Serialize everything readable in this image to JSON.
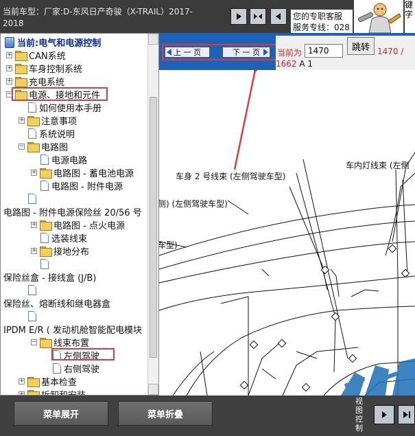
{
  "header": {
    "vehicle_line1": "当前车型：厂家:D-东风日产奇骏（X-TRAIL）2017-",
    "vehicle_line2": "2018",
    "service_line1": "您的专职客服",
    "service_line2": "服务专线：028",
    "edge_text": "键字"
  },
  "tree": {
    "root": "当前:电气和电源控制",
    "items": [
      {
        "label": "CAN系统"
      },
      {
        "label": "车身控制系统"
      },
      {
        "label": "充电系统"
      },
      {
        "label": "电源、接地和元件"
      },
      {
        "label": "如何使用本手册"
      },
      {
        "label": "注意事项"
      },
      {
        "label": "系统说明"
      },
      {
        "label": "电路图"
      },
      {
        "label": "电源电路"
      },
      {
        "label": "电路图 - 蓄电池电源"
      },
      {
        "label": "电路图 - 附件电源"
      },
      {
        "label": "电路图 - 附件电源保险丝 20/56 号"
      },
      {
        "label": "电路图 - 点火电源"
      },
      {
        "label": "选装线束"
      },
      {
        "label": "接地分布"
      },
      {
        "label": "保险丝盒 - 接线盒 (J/B)"
      },
      {
        "label": "保险丝、熔断线和继电器盒"
      },
      {
        "label": "IPDM E/R ( 发动机舱智能配电模块"
      },
      {
        "label": "线束布置"
      },
      {
        "label": "左侧驾驶"
      },
      {
        "label": "右侧驾驶"
      },
      {
        "label": "基本检查"
      },
      {
        "label": "拆卸和安装"
      }
    ]
  },
  "viewer": {
    "prev_label": "上 一 页",
    "next_label": "下 一 页",
    "current_label": "当前为",
    "page_value": "1470",
    "jump_label": "跳转",
    "page_of": "1470 /",
    "page_total": "1662",
    "page_suffix": "A 1"
  },
  "diagram": {
    "label_body_harness": "车身 2 号线束 (左侧驾驶车型)",
    "label_roof_harness": "车内灯线束 (左侧",
    "label_left_drive": "侧) (左侧驾驶车型)",
    "label_model": "车型)"
  },
  "bottom": {
    "expand_label": "菜单展开",
    "collapse_label": "菜单折叠",
    "view_ctrl": "视图控制"
  },
  "colors": {
    "header_bg": "#3b3b3b",
    "viewer_blue": "#1c62b8",
    "highlight_red": "#e23a3a",
    "page_red": "#dd2222",
    "watermark_blue": "#1e6fb8"
  }
}
